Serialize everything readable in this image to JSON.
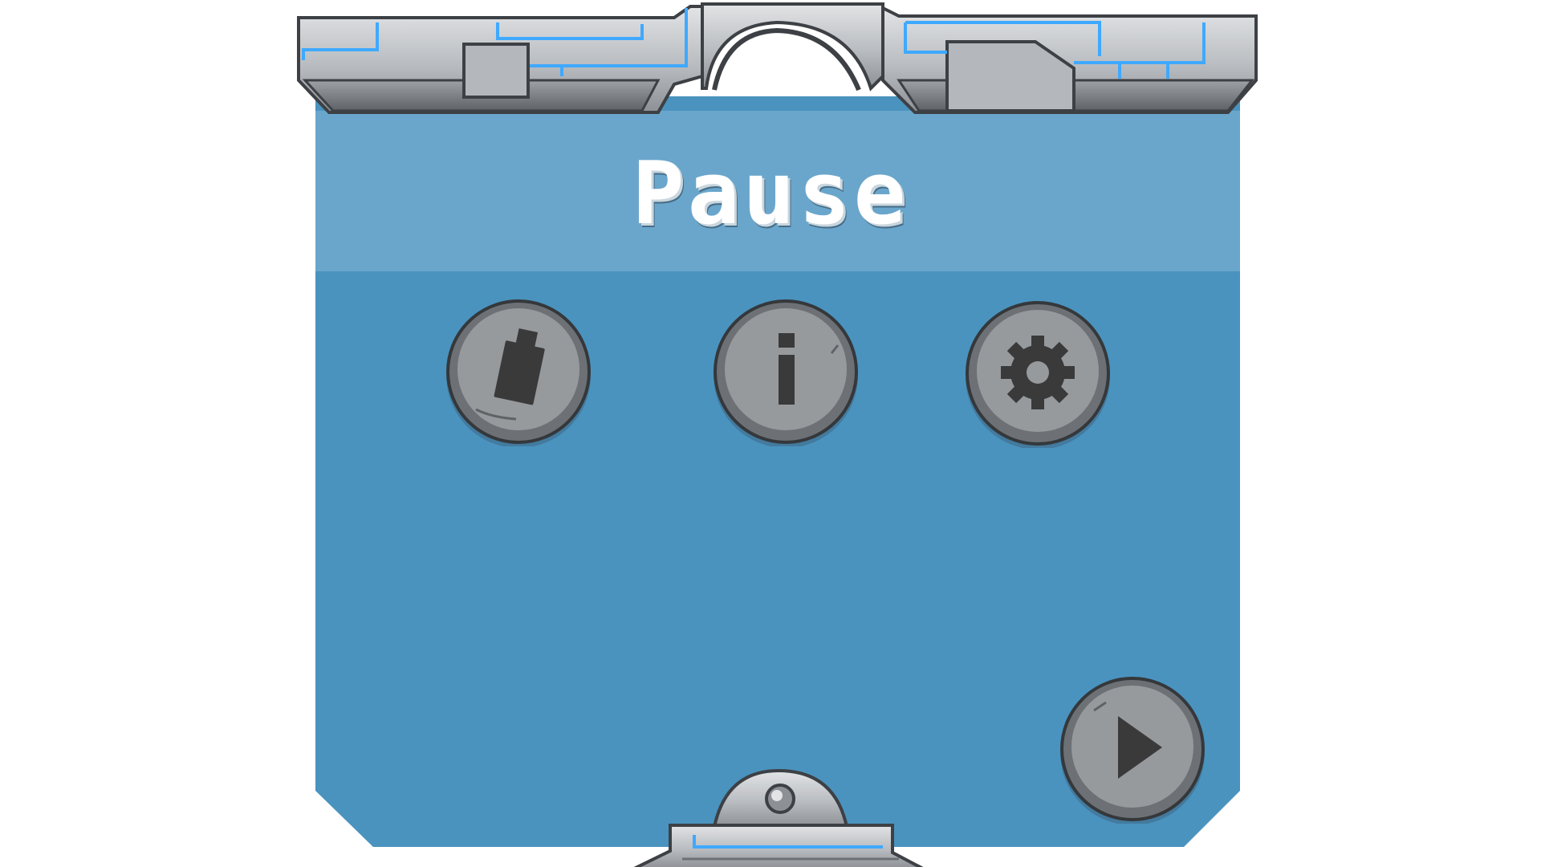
{
  "dialog": {
    "title": "Pause"
  },
  "buttons": {
    "save": {
      "icon": "usb-drive-icon"
    },
    "info": {
      "icon": "info-icon"
    },
    "settings": {
      "icon": "gear-icon"
    },
    "resume": {
      "icon": "play-icon"
    }
  },
  "colors": {
    "panel": "#4a93bf",
    "header_band": "#6aa6cb",
    "metal_light": "#c9ccd0",
    "metal_dark": "#6d7175",
    "accent_glow": "#3fa9ff",
    "button_face": "#8e9194",
    "icon": "#3a3a3a"
  }
}
